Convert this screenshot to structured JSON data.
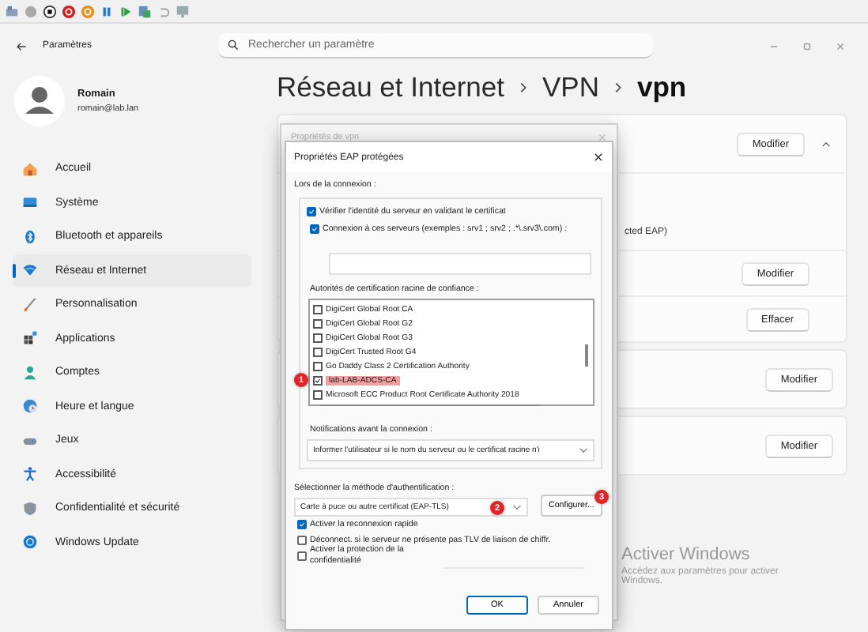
{
  "window": {
    "title": "Paramètres"
  },
  "search": {
    "placeholder": "Rechercher un paramètre"
  },
  "user": {
    "name": "Romain",
    "email": "romain@lab.lan"
  },
  "sidebar": {
    "items": [
      {
        "label": "Accueil",
        "kind": "home",
        "selected": false
      },
      {
        "label": "Système",
        "kind": "system",
        "selected": false
      },
      {
        "label": "Bluetooth et appareils",
        "kind": "bluetooth",
        "selected": false
      },
      {
        "label": "Réseau et Internet",
        "kind": "network",
        "selected": true
      },
      {
        "label": "Personnalisation",
        "kind": "brush",
        "selected": false
      },
      {
        "label": "Applications",
        "kind": "apps",
        "selected": false
      },
      {
        "label": "Comptes",
        "kind": "account",
        "selected": false
      },
      {
        "label": "Heure et langue",
        "kind": "time",
        "selected": false
      },
      {
        "label": "Jeux",
        "kind": "games",
        "selected": false
      },
      {
        "label": "Accessibilité",
        "kind": "accessibility",
        "selected": false
      },
      {
        "label": "Confidentialité et sécurité",
        "kind": "shield",
        "selected": false
      },
      {
        "label": "Windows Update",
        "kind": "update",
        "selected": false
      }
    ]
  },
  "breadcrumb": [
    "Réseau et Internet",
    "VPN",
    "vpn"
  ],
  "panel": {
    "cards": [
      {
        "rows": [
          {
            "kind": "button",
            "button": "Modifier",
            "expanded": true
          },
          {
            "kind": "text",
            "text": "cted EAP)"
          },
          {
            "kind": "button",
            "button": "Modifier"
          },
          {
            "kind": "button",
            "button": "Effacer"
          }
        ]
      },
      {
        "rows": [
          {
            "kind": "button",
            "button": "Modifier"
          }
        ]
      },
      {
        "rows": [
          {
            "kind": "button",
            "button": "Modifier"
          }
        ]
      }
    ]
  },
  "back_dialog": {
    "title": "Propriétés de vpn"
  },
  "dialog": {
    "title": "Propriétés EAP protégées",
    "section_label": "Lors de la connexion :",
    "verify": {
      "label": "Vérifier l'identité du serveur en validant le certificat",
      "checked": true
    },
    "servers": {
      "label": "Connexion à ces serveurs (exemples : srv1 ; srv2 ; .*\\.srv3\\.com) :",
      "checked": true
    },
    "ca_label": "Autorités de certification racine de confiance :",
    "ca_list": [
      {
        "label": "DigiCert Global Root CA",
        "checked": false,
        "highlighted": false
      },
      {
        "label": "DigiCert Global Root G2",
        "checked": false,
        "highlighted": false
      },
      {
        "label": "DigiCert Global Root G3",
        "checked": false,
        "highlighted": false
      },
      {
        "label": "DigiCert Trusted Root G4",
        "checked": false,
        "highlighted": false
      },
      {
        "label": "Go Daddy Class 2 Certification Authority",
        "checked": false,
        "highlighted": false
      },
      {
        "label": "lab-LAB-ADCS-CA",
        "checked": true,
        "highlighted": true,
        "badge": "1"
      },
      {
        "label": "Microsoft ECC Product Root Certificate Authority 2018",
        "checked": false,
        "highlighted": false
      }
    ],
    "notify_label": "Notifications avant la connexion :",
    "notify_value": "Informer l'utilisateur si le nom du serveur ou le certificat racine n'i",
    "method_label": "Sélectionner la méthode d'authentification :",
    "method_value": "Carte à puce ou autre certificat (EAP-TLS)",
    "method_badge": "2",
    "configure": "Configurer...",
    "configure_badge": "3",
    "options": [
      {
        "label": "Activer la reconnexion rapide",
        "checked": true
      },
      {
        "label": "Déconnect. si le serveur ne présente pas TLV de liaison de chiffr.",
        "checked": false
      },
      {
        "label": "Activer la protection de la confidentialité",
        "checked": false
      }
    ],
    "buttons": [
      "OK",
      "Annuler"
    ]
  },
  "activation_notice": {
    "title": "Activer Windows",
    "text": "Accédez aux paramètres pour activer Windows."
  }
}
